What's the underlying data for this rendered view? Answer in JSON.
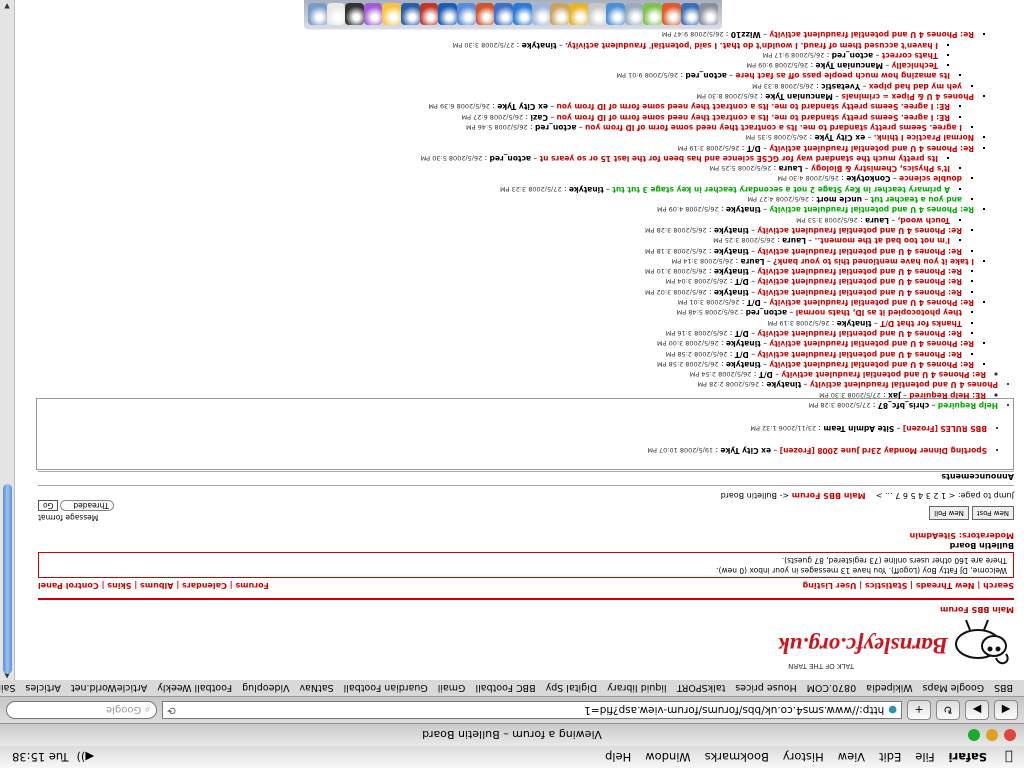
{
  "menubar": {
    "apple": "",
    "items": [
      "Safari",
      "File",
      "Edit",
      "View",
      "History",
      "Bookmarks",
      "Window",
      "Help"
    ],
    "clock": "Tue 15:38",
    "volume": "◀))"
  },
  "window": {
    "title": "Viewing a forum – Bulletin Board",
    "url": "http://www.sms4.co.uk/bbs/forums/forum-view.asp?fid=1",
    "search_placeholder": "Google"
  },
  "bookmarks": [
    "BBS",
    "Google Maps",
    "Wikipedia",
    "0870.COM",
    "House prices",
    "talkSPORT",
    "liquid library",
    "Digital Spy",
    "BBC Football",
    "Gmail",
    "Guardian Football",
    "SatNav",
    "Videoplug",
    "Football Weekly",
    "ArticleWorld.net",
    "Articles",
    "Sainsbury's",
    "Google",
    "BBC – Film"
  ],
  "page": {
    "logo_text": "Barnsleyfc.org.uk",
    "logo_tag": "TALK OF THE TARN",
    "breadcrumb": "Main BBS Forum",
    "nav_left": "Search | New Threads | Statistics | User Listing",
    "nav_right": "Forums | Calendars | Albums | Skins | Control Panel",
    "welcome_line1": "Welcome, DJ Fatty Boy (Logoff). You have 13 messages in your inbox (0 new).",
    "welcome_line2": "There are 160 other users online (73 registered, 87 guests).",
    "board_title": "Bulletin Board",
    "moderators": "Moderators: SiteAdmin",
    "new_post": "New Post",
    "new_poll": "New Poll",
    "message_format_label": "Message format",
    "message_format_value": "Threaded",
    "go_label": "Go",
    "jump_label": "Jump to page: < 1 2 3 4 5 6 7 ... >",
    "forum_crumb": "Main BBS Forum",
    "forum_crumb_rest": "<- Bulletin Board",
    "announcements_title": "Announcements",
    "announcements": [
      {
        "title": "Sporting Dinner Monday 23rd June 2008",
        "frozen": "[Frozen]",
        "author": "ex City Tyke",
        "date": "19/5/2008 10:07 PM"
      },
      {
        "title": "BBS RULES",
        "frozen": "[Frozen]",
        "author": "Site Admin Team",
        "date": "23/11/2006 1:32 PM"
      }
    ]
  },
  "threads": [
    {
      "title": "Help Required",
      "author": "chris_bfc_87",
      "date": "27/5/2008 3:28 PM",
      "green": true,
      "children": [
        {
          "title": "RE: Help Required",
          "author": "Jax",
          "date": "27/5/2008 3:30 PM"
        }
      ]
    },
    {
      "title": "Phones 4 U and potential fraudulent activity",
      "author": "tinatyke",
      "date": "26/5/2008 2:28 PM",
      "children": [
        {
          "title": "Re: Phones 4 U and potential fraudulent activity",
          "author": "D/T",
          "date": "26/5/2008 2:54 PM",
          "children": [
            {
              "title": "Re: Phones 4 U and potential fraudulent activity",
              "author": "tinatyke",
              "date": "26/5/2008 2:58 PM",
              "children": [
                {
                  "title": "Re: Phones 4 U and potential fraudulent activity",
                  "author": "D/T",
                  "date": "26/5/2008 2:58 PM"
                }
              ]
            },
            {
              "title": "Re: Phones 4 U and potential fraudulent activity",
              "author": "tinatyke",
              "date": "26/5/2008 3:00 PM",
              "children": [
                {
                  "title": "Re: Phones 4 U and potential fraudulent activity",
                  "author": "D/T",
                  "date": "26/5/2008 3:16 PM"
                },
                {
                  "title": "Thanks for that D/T",
                  "author": "tinatyke",
                  "date": "26/5/2008 3:19 PM"
                },
                {
                  "title": "they photocopied it as ID, thats normal",
                  "author": "acton_red",
                  "date": "26/5/2008 5:48 PM"
                }
              ]
            },
            {
              "title": "Re: Phones 4 U and potential fraudulent activity",
              "author": "D/T",
              "date": "26/5/2008 3:01 PM",
              "children": [
                {
                  "title": "Re: Phones 4 U and potential fraudulent activity",
                  "author": "tinatyke",
                  "date": "26/5/2008 3:02 PM"
                },
                {
                  "title": "Re: Phones 4 U and potential fraudulent activity",
                  "author": "D/T",
                  "date": "26/5/2008 3:04 PM"
                },
                {
                  "title": "Re: Phones 4 U and potential fraudulent activity",
                  "author": "tinatyke",
                  "date": "26/5/2008 3:10 PM"
                }
              ]
            },
            {
              "title": "I take it you have mentioned this to your bank?",
              "author": "Laura",
              "date": "26/5/2008 3:14 PM",
              "children": [
                {
                  "title": "Re: Phones 4 U and potential fraudulent activity",
                  "author": "tinatyke",
                  "date": "26/5/2008 3:18 PM",
                  "children": [
                    {
                      "title": "I'm not too bad at the moment..",
                      "author": "Laura",
                      "date": "26/5/2008 3:25 PM"
                    }
                  ]
                },
                {
                  "title": "Re: Phones 4 U and potential fraudulent activity",
                  "author": "tinatyke",
                  "date": "26/5/2008 3:28 PM",
                  "children": [
                    {
                      "title": "Touch wood,",
                      "author": "Laura",
                      "date": "26/5/2008 3:53 PM"
                    }
                  ]
                }
              ]
            },
            {
              "title": "Re: Phones 4 U and potential fraudulent activity",
              "author": "tinatyke",
              "date": "26/5/2008 4:09 PM",
              "green": true,
              "children": [
                {
                  "title": "and you a teacher tut",
                  "author": "uncle mort",
                  "date": "26/5/2008 4:27 PM",
                  "green": true,
                  "children": [
                    {
                      "title": "A primary teacher in Key Stage 2 not a secondary teacher in key stage 3 tut tut",
                      "author": "tinatyke",
                      "date": "27/5/2008 3:23 PM",
                      "green": true
                    }
                  ]
                },
                {
                  "title": "double science",
                  "author": "Conkotyke",
                  "date": "26/5/2008 4:30 PM",
                  "children": [
                    {
                      "title": "It's Physics, Chemistry & Biology",
                      "author": "Laura",
                      "date": "26/5/2008 5:25 PM",
                      "children": [
                        {
                          "title": "Its pretty much the standard way for GCSE science and has been for the last 15 or so years nt",
                          "author": "acton_red",
                          "date": "26/5/2008 5:30 PM"
                        }
                      ]
                    }
                  ]
                }
              ]
            },
            {
              "title": "Re: Phones 4 U and potential fraudulent activity",
              "author": "D/T",
              "date": "26/5/2008 3:19 PM"
            },
            {
              "title": "Normal Practice I think.",
              "author": "ex City Tyke",
              "date": "26/5/2008 5:35 PM",
              "children": [
                {
                  "title": "I agree. Seems pretty standard to me. Its a contract they need some form of ID from you",
                  "author": "acton_red",
                  "date": "26/5/2008 5:46 PM",
                  "children": [
                    {
                      "title": "RE: I agree. Seems pretty standard to me. Its a contract they need some form of ID from you",
                      "author": "Cazi",
                      "date": "26/5/2008 6:27 PM"
                    },
                    {
                      "title": "RE: I agree. Seems pretty standard to me. Its a contract they need some form of ID from you",
                      "author": "ex City Tyke",
                      "date": "26/5/2008 6:39 PM"
                    }
                  ]
                }
              ]
            },
            {
              "title": "Phones 4 U & Pipex = criminals",
              "author": "Mancunian Tyke",
              "date": "26/5/2008 8:30 PM",
              "children": [
                {
                  "title": "yeh my dad had pipex",
                  "author": "Yvetastic",
                  "date": "26/5/2008 8:33 PM",
                  "children": [
                    {
                      "title": "Its amazing how much people pass off as fact here",
                      "author": "acton_red",
                      "date": "26/5/2008 9:01 PM",
                      "children": [
                        {
                          "title": "Technically",
                          "author": "Mancunian Tyke",
                          "date": "26/5/2008 9:09 PM"
                        },
                        {
                          "title": "Thats correct",
                          "author": "acton_red",
                          "date": "26/5/2008 9:17 PM"
                        },
                        {
                          "title": "I haven't accused them of fraud. I wouldn't do that. I said 'potential' fraudulent activity.",
                          "author": "tinatyke",
                          "date": "27/5/2008 3:30 PM"
                        }
                      ]
                    }
                  ]
                }
              ]
            },
            {
              "title": "Re: Phones 4 U and potential fraudulent activity",
              "author": "Wizz10",
              "date": "26/5/2008 9:47 PM"
            }
          ]
        }
      ]
    }
  ],
  "dock_colors": [
    "#8a8f99",
    "#3b6fb5",
    "#e05a2a",
    "#7fc24a",
    "#9ab",
    "#4a90d9",
    "#c8c8c8",
    "#e6b422",
    "#caa260",
    "#9fb6d8",
    "#2a7bd4",
    "#3b6fc8",
    "#d4542a",
    "#5a8ad8",
    "#1a5fb4",
    "#c2362a",
    "#2a5fa8",
    "#f5c542",
    "#a35bd6",
    "#333",
    "#e8e8e8",
    "#7a9ac8"
  ]
}
